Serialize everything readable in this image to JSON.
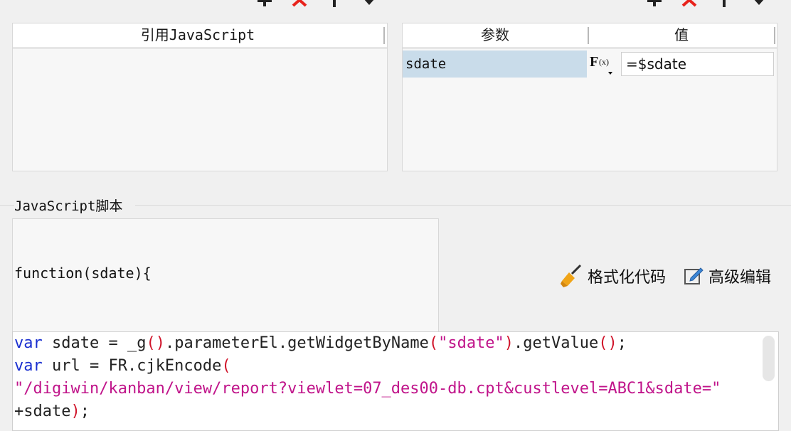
{
  "left_panel": {
    "header": "引用JavaScript"
  },
  "right_panel": {
    "header_param": "参数",
    "header_value": "值",
    "rows": [
      {
        "name": "sdate",
        "formula_icon": "F(x)",
        "value": "=$sdate"
      }
    ]
  },
  "toolbar_icons": [
    "add-icon",
    "delete-icon",
    "move-up-icon",
    "move-down-icon"
  ],
  "script_section": {
    "legend": "JavaScript脚本",
    "function_signature": "function(sdate){",
    "format_code_label": "格式化代码",
    "advanced_edit_label": "高级编辑"
  },
  "code": {
    "line1": {
      "kw": "var",
      "a": " sdate = _g",
      "p1": "()",
      "b": ".parameterEl.getWidgetByName",
      "p2": "(",
      "s": "\"sdate\"",
      "p3": ")",
      "c": ".getValue",
      "p4": "()",
      "d": ";"
    },
    "line2": {
      "kw": "var",
      "a": " url = FR.cjkEncode",
      "p": "("
    },
    "line3": {
      "s": "\"/digiwin/kanban/view/report?viewlet=07_des00-db.cpt&custlevel=ABC1&sdate=\""
    },
    "line4": {
      "a": "+sdate",
      "p": ")",
      "b": ";"
    }
  },
  "colors": {
    "keyword": "#1a2fd0",
    "string": "#c0148a",
    "paren": "#d0142a",
    "selected_row": "#c9dcea",
    "delete": "#e8221b"
  }
}
